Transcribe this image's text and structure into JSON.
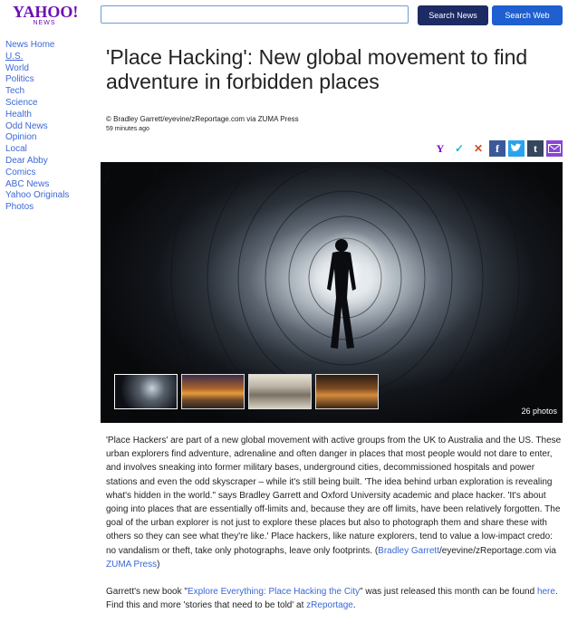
{
  "logo": {
    "brand": "YAHOO!",
    "sub": "NEWS"
  },
  "search": {
    "value": "",
    "news_button": "Search News",
    "web_button": "Search Web"
  },
  "sidebar": {
    "items": [
      {
        "label": "News Home"
      },
      {
        "label": "U.S."
      },
      {
        "label": "World"
      },
      {
        "label": "Politics"
      },
      {
        "label": "Tech"
      },
      {
        "label": "Science"
      },
      {
        "label": "Health"
      },
      {
        "label": "Odd News"
      },
      {
        "label": "Opinion"
      },
      {
        "label": "Local"
      },
      {
        "label": "Dear Abby"
      },
      {
        "label": "Comics"
      },
      {
        "label": "ABC News"
      },
      {
        "label": "Yahoo Originals"
      },
      {
        "label": "Photos"
      }
    ]
  },
  "article": {
    "headline": "'Place Hacking': New global movement to find adventure in forbidden places",
    "credit": "© Bradley Garrett/eyevine/zReportage.com via ZUMA Press",
    "time": "59 minutes ago",
    "photo_count": "26 photos",
    "body1": "'Place Hackers' are part of a new global movement with active groups from the UK to Australia and the US. These urban explorers find adventure, adrenaline and often danger in places that most people would not dare to enter, and involves sneaking into former military bases, underground cities, decommissioned hospitals and power stations and even the odd skyscraper – while it's still being built. 'The idea behind urban exploration is revealing what's hidden in the world.\" says Bradley Garrett and Oxford University academic and place hacker. 'It's about going into places that are essentially off-limits and, because they are off limits, have been relatively forgotten. The goal of the urban explorer is not just to explore these places but also to photograph them and share these with others so they can see what they're like.' Place hackers, like nature explorers, tend to value a low-impact credo: no vandalism or theft, take only photographs, leave only footprints. (",
    "body1_link1": "Bradley Garrett",
    "body1_mid": "/eyevine/zReportage.com via ",
    "body1_link2": "ZUMA Press",
    "body1_end": ")",
    "body2_start": "Garrett's new book \"",
    "body2_link": "Explore Everything: Place Hacking the City",
    "body2_end": "\" was just released this month can be found ",
    "body2_here": "here",
    "body2_dot": ".",
    "body3_start": "Find this and more 'stories that need to be told' at ",
    "body3_link": "zReportage",
    "body3_dot": "."
  },
  "share_icons": [
    "yahoo-icon",
    "check-icon",
    "close-icon",
    "facebook-icon",
    "twitter-icon",
    "tumblr-icon",
    "mail-icon"
  ],
  "colors": {
    "brand": "#6b0fb5",
    "link": "#3a68d6",
    "search_news_bg": "#1c2b63",
    "search_web_bg": "#1f5fcf"
  }
}
